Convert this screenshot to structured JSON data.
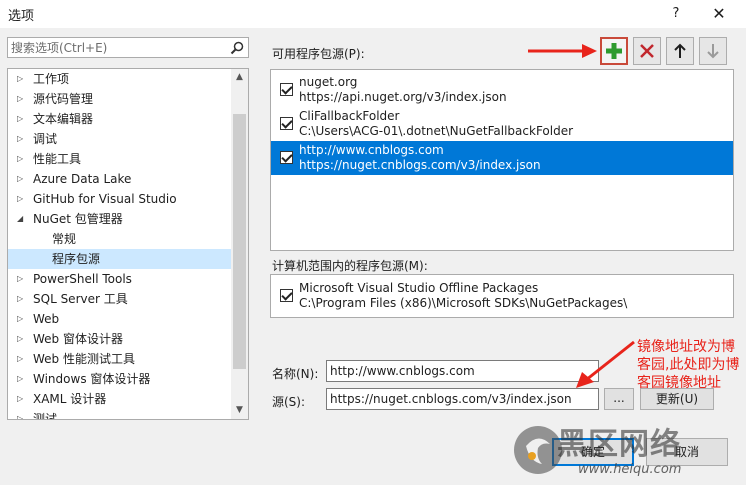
{
  "window": {
    "title": "选项",
    "help_glyph": "?",
    "close_glyph": "✕"
  },
  "search": {
    "placeholder": "搜索选项(Ctrl+E)"
  },
  "tree": {
    "items": [
      {
        "label": "工作项",
        "expanded": false,
        "child": false,
        "selected": false
      },
      {
        "label": "源代码管理",
        "expanded": false,
        "child": false,
        "selected": false
      },
      {
        "label": "文本编辑器",
        "expanded": false,
        "child": false,
        "selected": false
      },
      {
        "label": "调试",
        "expanded": false,
        "child": false,
        "selected": false
      },
      {
        "label": "性能工具",
        "expanded": false,
        "child": false,
        "selected": false
      },
      {
        "label": "Azure Data Lake",
        "expanded": false,
        "child": false,
        "selected": false
      },
      {
        "label": "GitHub for Visual Studio",
        "expanded": false,
        "child": false,
        "selected": false
      },
      {
        "label": "NuGet 包管理器",
        "expanded": true,
        "child": false,
        "selected": false
      },
      {
        "label": "常规",
        "expanded": false,
        "child": true,
        "selected": false
      },
      {
        "label": "程序包源",
        "expanded": false,
        "child": true,
        "selected": true
      },
      {
        "label": "PowerShell Tools",
        "expanded": false,
        "child": false,
        "selected": false
      },
      {
        "label": "SQL Server 工具",
        "expanded": false,
        "child": false,
        "selected": false
      },
      {
        "label": "Web",
        "expanded": false,
        "child": false,
        "selected": false
      },
      {
        "label": "Web 窗体设计器",
        "expanded": false,
        "child": false,
        "selected": false
      },
      {
        "label": "Web 性能测试工具",
        "expanded": false,
        "child": false,
        "selected": false
      },
      {
        "label": "Windows 窗体设计器",
        "expanded": false,
        "child": false,
        "selected": false
      },
      {
        "label": "XAML 设计器",
        "expanded": false,
        "child": false,
        "selected": false
      },
      {
        "label": "测试",
        "expanded": false,
        "child": false,
        "selected": false
      }
    ]
  },
  "sources": {
    "label": "可用程序包源(P):",
    "items": [
      {
        "name": "nuget.org",
        "url": "https://api.nuget.org/v3/index.json",
        "checked": true,
        "selected": false
      },
      {
        "name": "CliFallbackFolder",
        "url": "C:\\Users\\ACG-01\\.dotnet\\NuGetFallbackFolder",
        "checked": true,
        "selected": false
      },
      {
        "name": "http://www.cnblogs.com",
        "url": "https://nuget.cnblogs.com/v3/index.json",
        "checked": true,
        "selected": true
      }
    ]
  },
  "machine_sources": {
    "label": "计算机范围内的程序包源(M):",
    "items": [
      {
        "name": "Microsoft Visual Studio Offline Packages",
        "url": "C:\\Program Files (x86)\\Microsoft SDKs\\NuGetPackages\\",
        "checked": true
      }
    ]
  },
  "form": {
    "name_label": "名称(N):",
    "name_value": "http://www.cnblogs.com",
    "source_label": "源(S):",
    "source_value": "https://nuget.cnblogs.com/v3/index.json",
    "browse_label": "...",
    "update_label": "更新(U)"
  },
  "annotation": {
    "text": "镜像地址改为博客园,此处即为博客园镜像地址",
    "color": "#e8241b"
  },
  "buttons": {
    "ok": "确定",
    "cancel": "取消"
  },
  "watermark": {
    "title": "黑区网络",
    "url": "www.heiqu.com"
  },
  "colors": {
    "selection": "#0078d7",
    "tree_selection": "#cce8ff",
    "add_icon": "#2e9a2e",
    "remove_icon": "#c1272d",
    "highlight_border": "#c94a3a"
  }
}
